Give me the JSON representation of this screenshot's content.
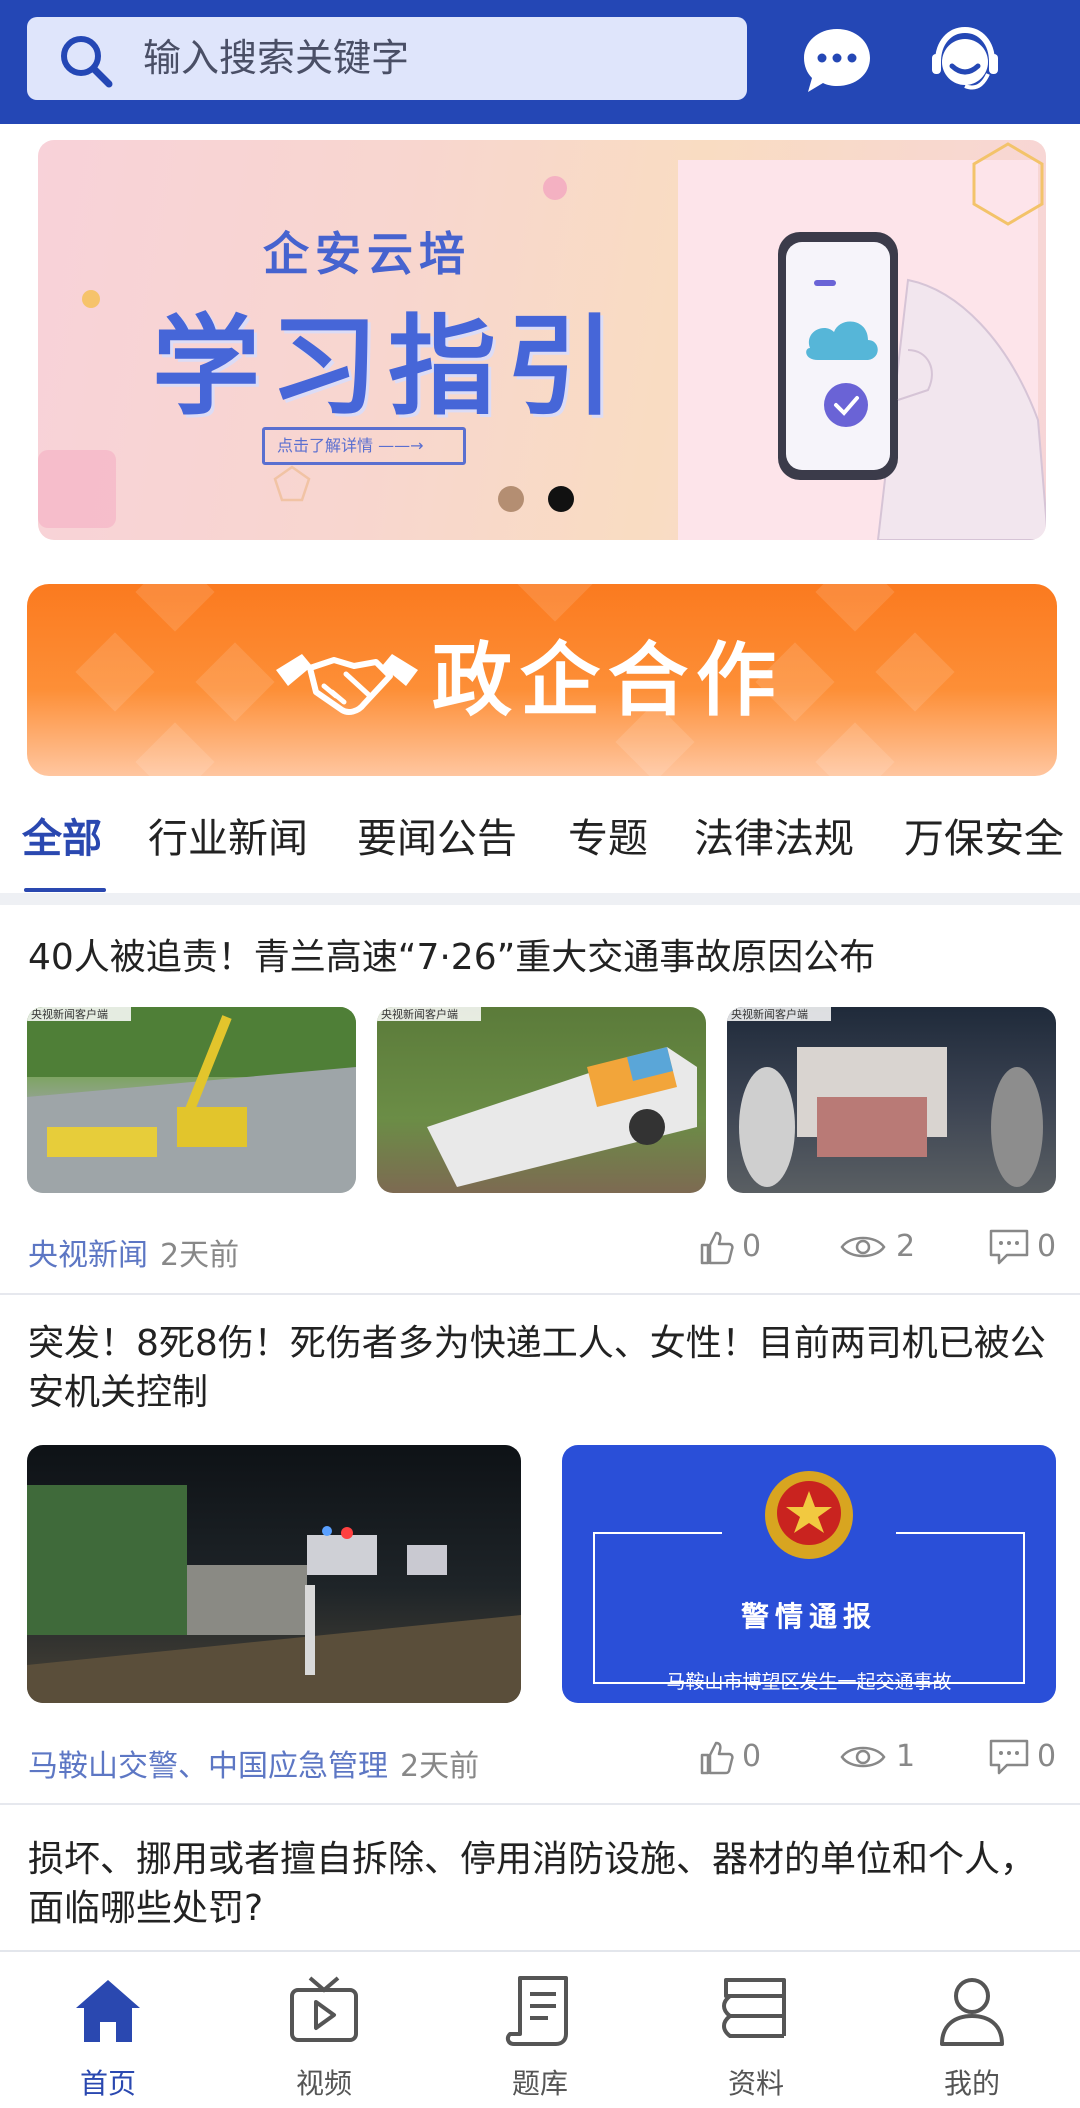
{
  "header": {
    "search_placeholder": "输入搜索关键字",
    "icons": [
      "search-icon",
      "chat-icon",
      "customer-service-icon"
    ]
  },
  "banner": {
    "subtitle": "企安云培",
    "title": "学习指引",
    "cta": "点击了解详情 ——→",
    "carousel": {
      "count": 2,
      "active_index": 1
    }
  },
  "gov_banner": {
    "text": "政企合作",
    "icon": "handshake-icon"
  },
  "tabs": [
    {
      "label": "全部",
      "active": true
    },
    {
      "label": "行业新闻"
    },
    {
      "label": "要闻公告"
    },
    {
      "label": "专题"
    },
    {
      "label": "法律法规"
    },
    {
      "label": "万保安全"
    }
  ],
  "articles": [
    {
      "title": "40人被追责！青兰高速“7·26”重大交通事故原因公布",
      "images": [
        {
          "watermark": "央视新闻客户端",
          "desc": "crane-at-accident-scene"
        },
        {
          "watermark": "央视新闻客户端",
          "desc": "crashed-bus"
        },
        {
          "watermark": "央视新闻客户端",
          "desc": "rescue-at-night"
        }
      ],
      "source": "央视新闻",
      "time": "2天前",
      "likes": "0",
      "views": "2",
      "comments": "0"
    },
    {
      "title": "突发！8死8伤！死伤者多为快递工人、女性！目前两司机已被公安机关控制",
      "images": [
        {
          "desc": "night-accident-scene"
        },
        {
          "desc": "police-notice",
          "heading": "警情通报",
          "caption": "马鞍山市博望区发生一起交通事故"
        }
      ],
      "source": "马鞍山交警、中国应急管理",
      "time": "2天前",
      "likes": "0",
      "views": "1",
      "comments": "0"
    },
    {
      "title": "损坏、挪用或者擅自拆除、停用消防设施、器材的单位和个人，面临哪些处罚?"
    }
  ],
  "bottom_nav": [
    {
      "label": "首页",
      "icon": "home-icon",
      "active": true
    },
    {
      "label": "视频",
      "icon": "video-icon"
    },
    {
      "label": "题库",
      "icon": "question-bank-icon"
    },
    {
      "label": "资料",
      "icon": "materials-icon"
    },
    {
      "label": "我的",
      "icon": "profile-icon"
    }
  ],
  "colors": {
    "header_bg": "#2447b5",
    "accent": "#2a48b0",
    "gov_orange": "#fb7a1f",
    "source_blue": "#5d77c4"
  }
}
